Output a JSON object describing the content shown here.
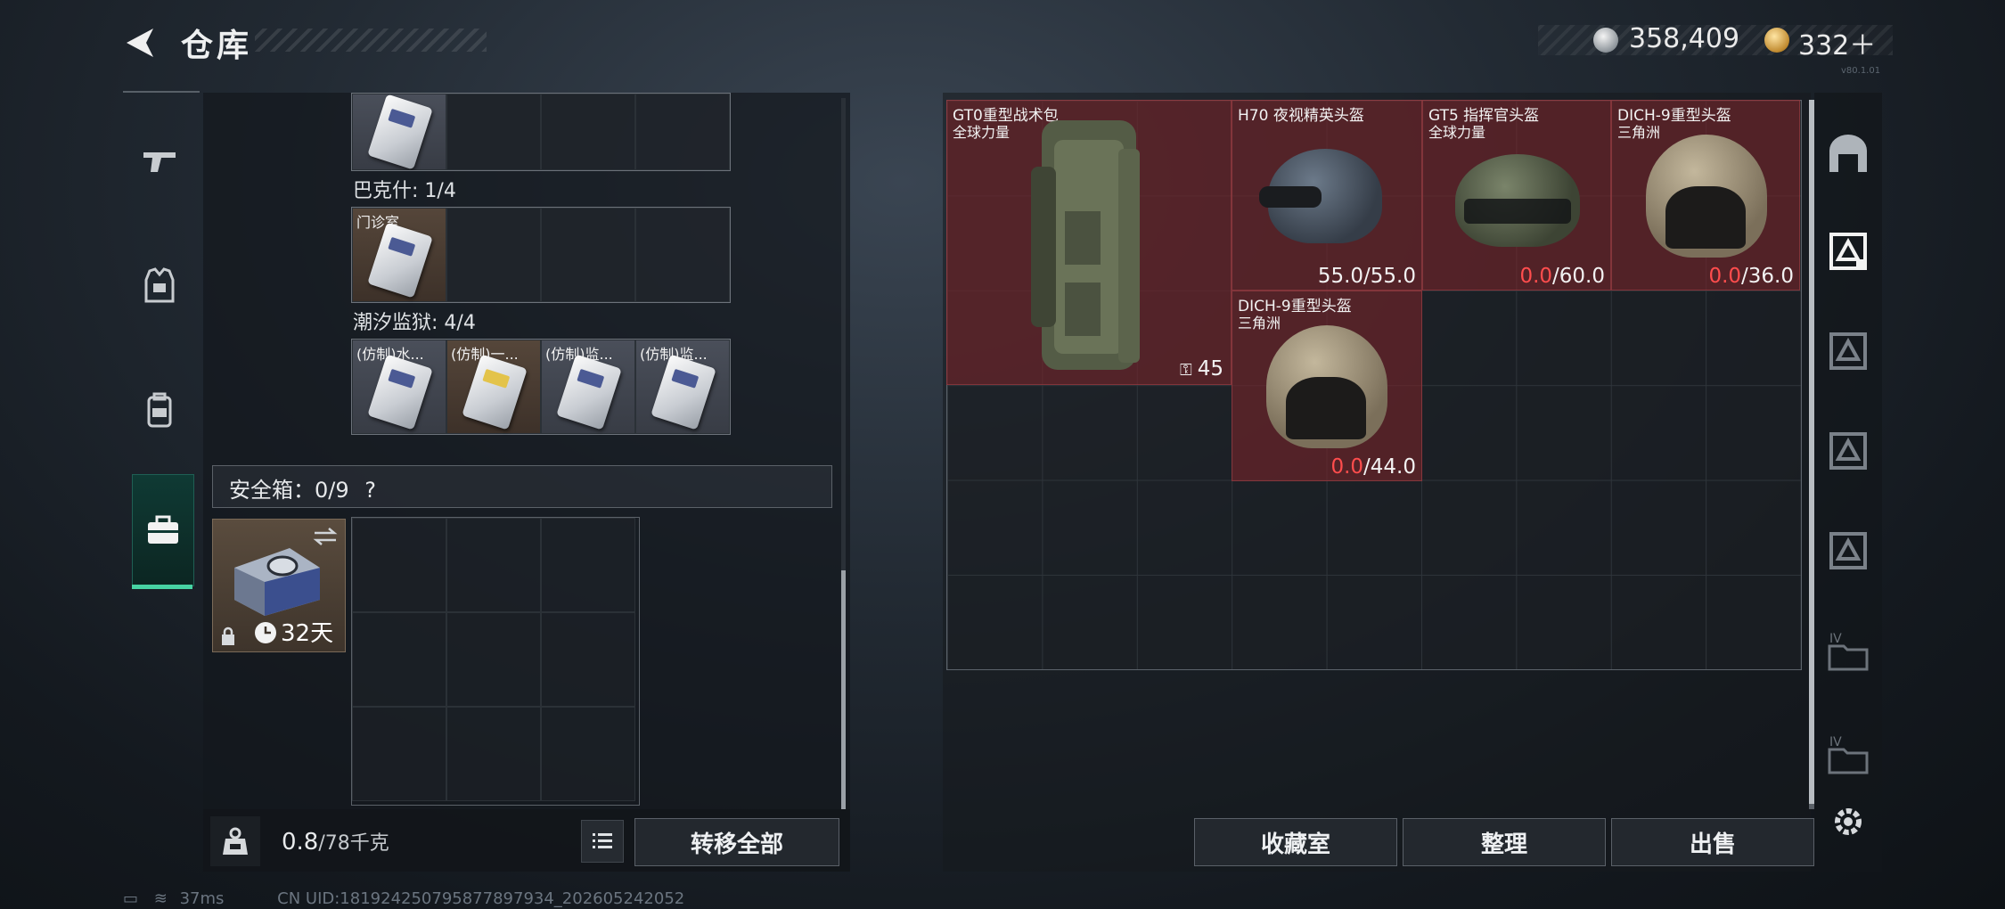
{
  "header": {
    "title": "仓库"
  },
  "currency": {
    "silver": "358,409",
    "gold": "332＋",
    "version": "v80.1.01"
  },
  "left_nav": {
    "tabs": [
      "weapons-tab",
      "armor-tab",
      "backpack-tab",
      "safe-tab"
    ]
  },
  "container_rows": [
    {
      "label": "",
      "items": [
        {
          "name": "",
          "tint": "gray"
        }
      ]
    },
    {
      "label": "巴克什: 1/4",
      "items": [
        {
          "name": "门诊室",
          "tint": "tan"
        }
      ]
    },
    {
      "label": "潮汐监狱: 4/4",
      "items": [
        {
          "name": "(仿制)水...",
          "tint": "gray"
        },
        {
          "name": "(仿制)一...",
          "tint": "tan"
        },
        {
          "name": "(仿制)监...",
          "tint": "gray"
        },
        {
          "name": "(仿制)监...",
          "tint": "gray"
        }
      ]
    }
  ],
  "safe_box": {
    "label": "安全箱：0/9",
    "help": "?",
    "days": "32天"
  },
  "weight": {
    "current": "0.8",
    "max": "/78千克"
  },
  "buttons": {
    "transfer_all": "转移全部",
    "collection": "收藏室",
    "organize": "整理",
    "sell": "出售"
  },
  "stash_items": [
    {
      "name": "GT0重型战术包",
      "sub": "全球力量",
      "badge": "45"
    },
    {
      "name": "H70 夜视精英头盔",
      "sub": "",
      "durability": "55.0",
      "max": "/55.0"
    },
    {
      "name": "GT5 指挥官头盔",
      "sub": "全球力量",
      "durability": "0.0",
      "max": "/60.0"
    },
    {
      "name": "DICH-9重型头盔",
      "sub": "三角洲",
      "durability": "0.0",
      "max": "/36.0"
    },
    {
      "name": "DICH-9重型头盔",
      "sub": "三角洲",
      "durability": "0.0",
      "max": "/44.0"
    }
  ],
  "status_bar": {
    "ping": "37ms",
    "uid": "CN UID:18192425079587789​7934_202605242052"
  },
  "colors": {
    "accent_green": "#47d3a3",
    "durability_red": "#ff4d4d",
    "item_bg": "#78242a"
  }
}
